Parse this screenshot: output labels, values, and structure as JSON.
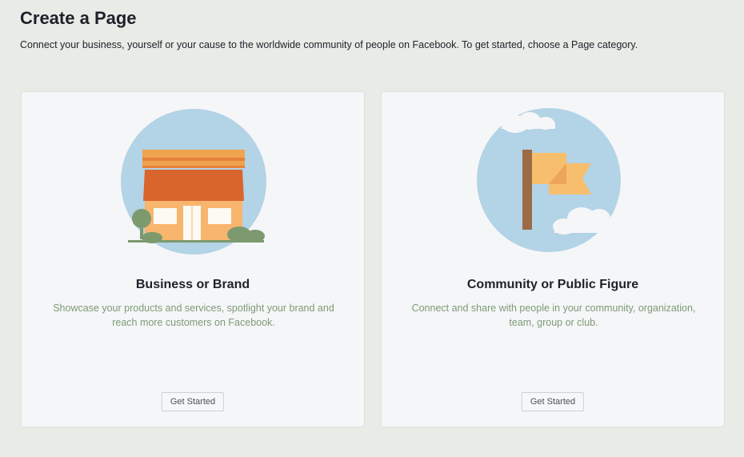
{
  "header": {
    "title": "Create a Page",
    "subtitle": "Connect your business, yourself or your cause to the worldwide community of people on Facebook. To get started, choose a Page category."
  },
  "cards": [
    {
      "title": "Business or Brand",
      "description": "Showcase your products and services, spotlight your brand and reach more customers on Facebook.",
      "button_label": "Get Started",
      "illustration": "storefront-icon"
    },
    {
      "title": "Community or Public Figure",
      "description": "Connect and share with people in your community, organization, team, group or club.",
      "button_label": "Get Started",
      "illustration": "flag-icon"
    }
  ],
  "colors": {
    "background": "#e9ebe6",
    "card_background": "#f5f6f7",
    "description_text": "#7d9a78",
    "circle": "#b3d3e6",
    "awning": "#d9652d",
    "wall": "#f7b56d",
    "flag": "#f7bf6d",
    "pole": "#9a6b45",
    "tree": "#7c9a6e"
  }
}
